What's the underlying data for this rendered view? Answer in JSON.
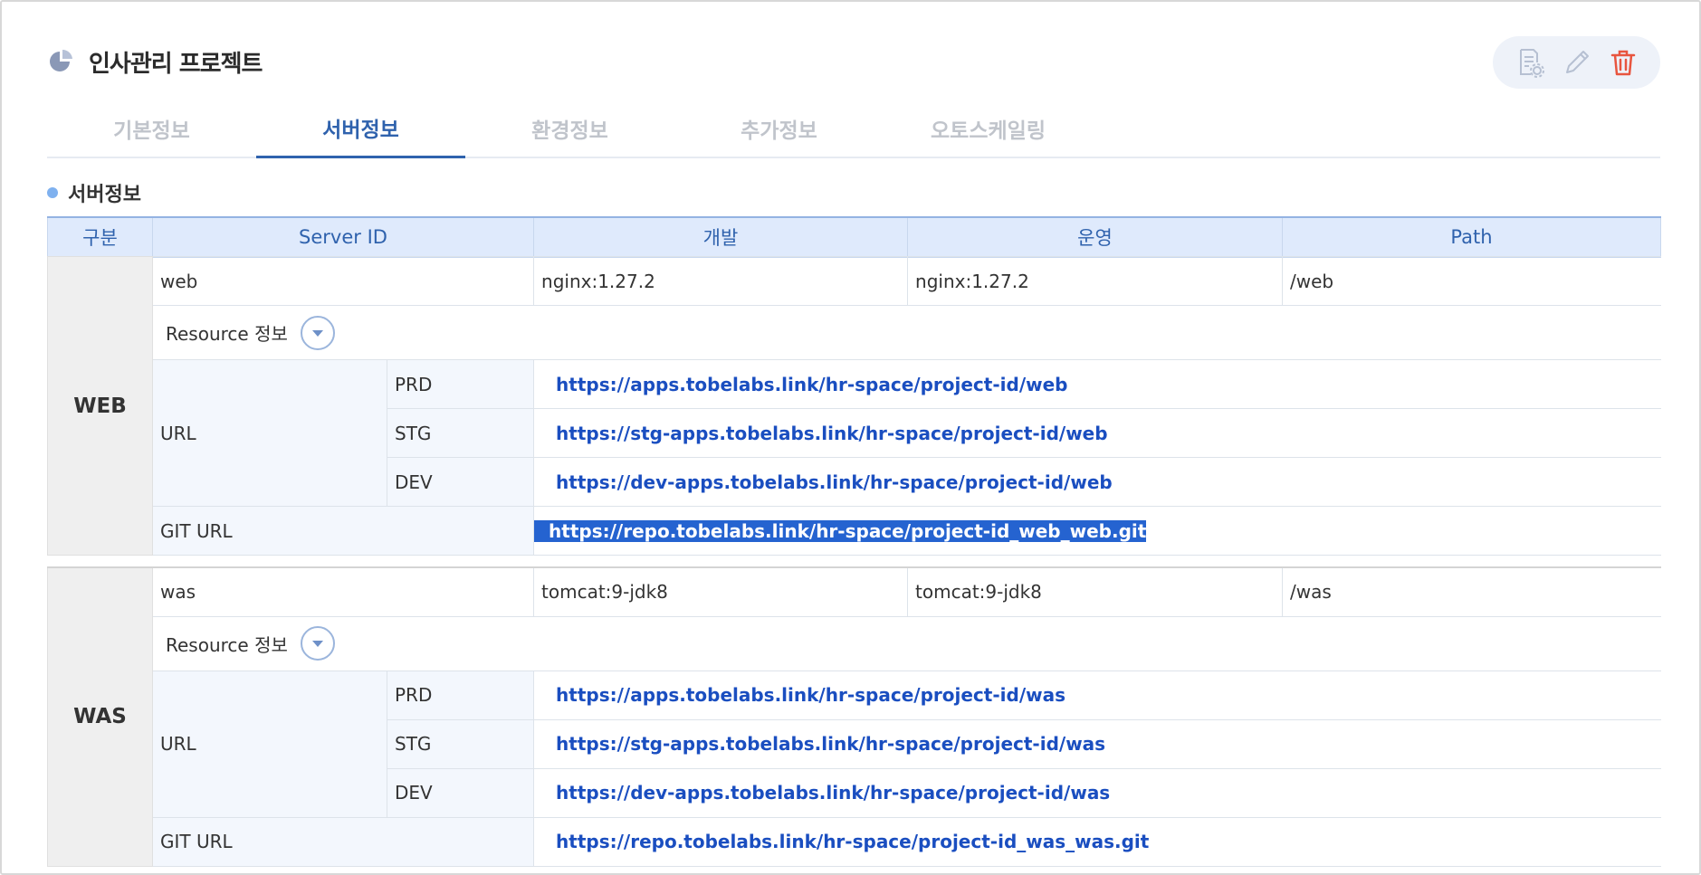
{
  "project": {
    "title": "인사관리 프로젝트"
  },
  "actions": {
    "settings": "document-gear-icon",
    "edit": "pencil-icon",
    "delete": "trash-icon"
  },
  "tabs": [
    {
      "label": "기본정보",
      "active": false
    },
    {
      "label": "서버정보",
      "active": true
    },
    {
      "label": "환경정보",
      "active": false
    },
    {
      "label": "추가정보",
      "active": false
    },
    {
      "label": "오토스케일링",
      "active": false
    }
  ],
  "section": {
    "title": "서버정보"
  },
  "table": {
    "headers": [
      "구분",
      "Server ID",
      "개발",
      "운영",
      "Path"
    ],
    "resource_label": "Resource 정보",
    "url_label": "URL",
    "git_label": "GIT URL",
    "groups": [
      {
        "name": "WEB",
        "server_id": "web",
        "dev": "nginx:1.27.2",
        "prod": "nginx:1.27.2",
        "path": "/web",
        "urls": [
          {
            "env": "PRD",
            "url": "https://apps.tobelabs.link/hr-space/project-id/web"
          },
          {
            "env": "STG",
            "url": "https://stg-apps.tobelabs.link/hr-space/project-id/web"
          },
          {
            "env": "DEV",
            "url": "https://dev-apps.tobelabs.link/hr-space/project-id/web"
          }
        ],
        "git_url": "https://repo.tobelabs.link/hr-space/project-id_web_web.git"
      },
      {
        "name": "WAS",
        "server_id": "was",
        "dev": "tomcat:9-jdk8",
        "prod": "tomcat:9-jdk8",
        "path": "/was",
        "urls": [
          {
            "env": "PRD",
            "url": "https://apps.tobelabs.link/hr-space/project-id/was"
          },
          {
            "env": "STG",
            "url": "https://stg-apps.tobelabs.link/hr-space/project-id/was"
          },
          {
            "env": "DEV",
            "url": "https://dev-apps.tobelabs.link/hr-space/project-id/was"
          }
        ],
        "git_url": "https://repo.tobelabs.link/hr-space/project-id_was_was.git"
      }
    ]
  },
  "colors": {
    "accent": "#2f62ad",
    "link": "#1a4ec0",
    "header_bg": "#dfeafc",
    "delete": "#e8553f"
  }
}
